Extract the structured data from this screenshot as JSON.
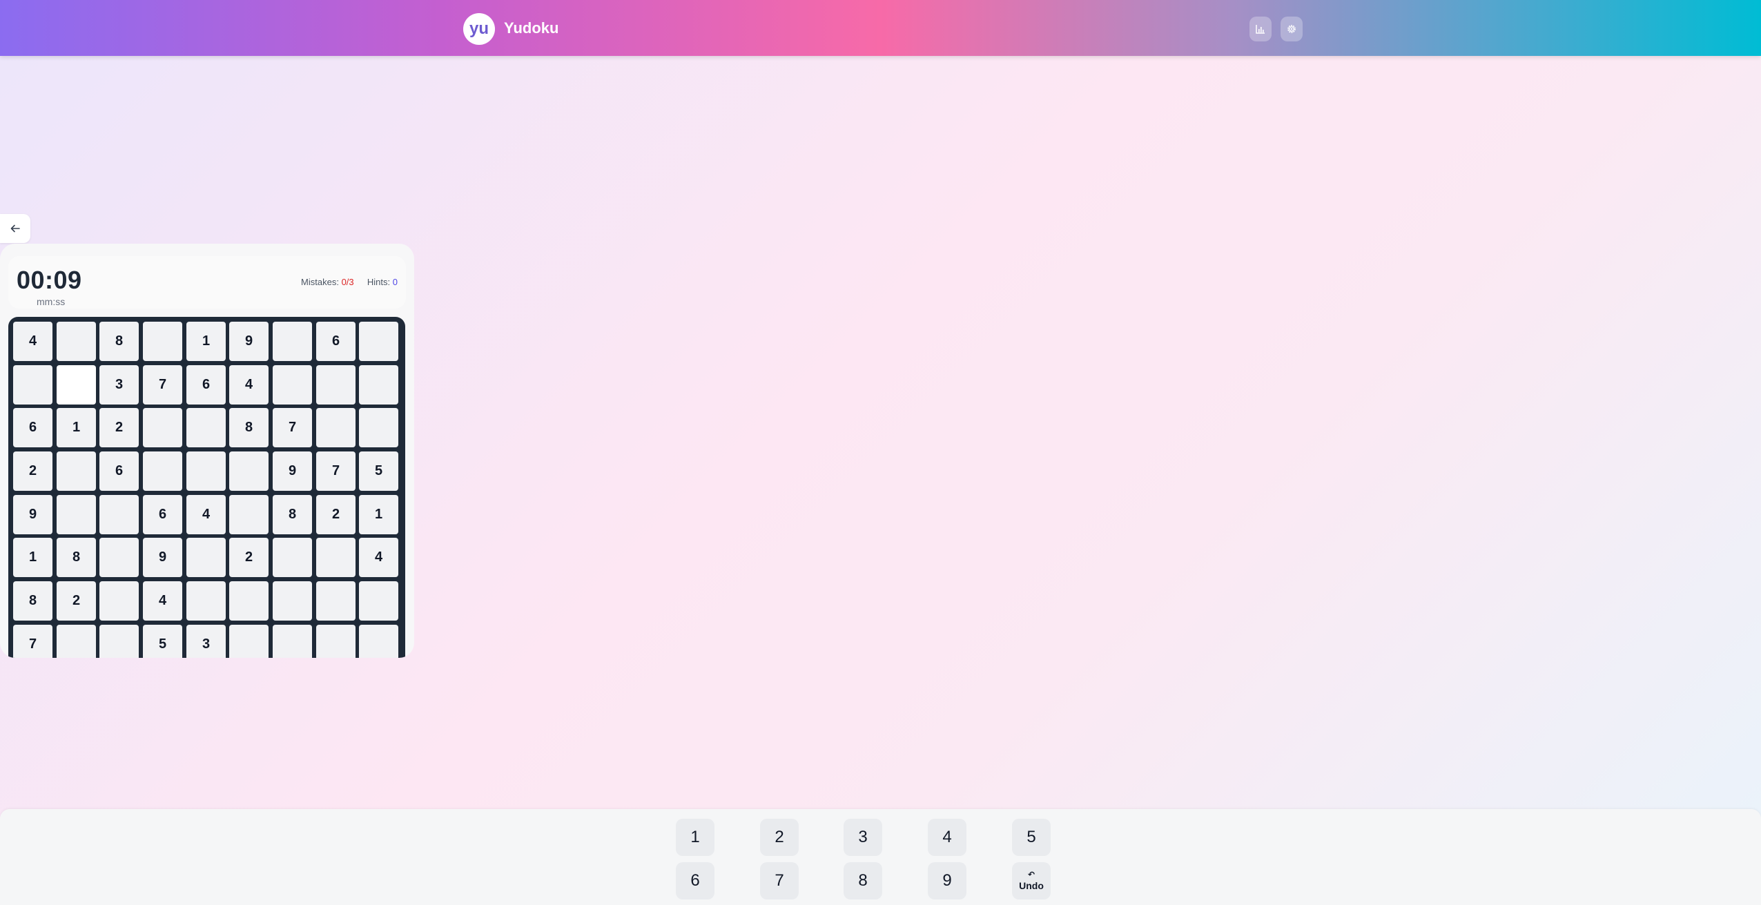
{
  "header": {
    "logo_text": "yu",
    "app_title": "Yudoku",
    "buttons": [
      {
        "name": "stats-button",
        "icon": "bar-chart-icon"
      },
      {
        "name": "settings-button",
        "icon": "gear-icon"
      }
    ]
  },
  "back": {
    "icon": "arrow-left-icon"
  },
  "game": {
    "timer": "00:09",
    "timer_unit": "mm:ss",
    "mistakes_label": "Mistakes:",
    "mistakes_value": "0/3",
    "hints_label": "Hints:",
    "hints_value": "0"
  },
  "board": {
    "rows": [
      [
        "4",
        "",
        "8",
        "",
        "1",
        "9",
        "",
        "6",
        ""
      ],
      [
        "",
        "",
        "3",
        "7",
        "6",
        "4",
        "",
        "",
        ""
      ],
      [
        "6",
        "1",
        "2",
        "",
        "",
        "8",
        "7",
        "",
        ""
      ],
      [
        "2",
        "",
        "6",
        "",
        "",
        "",
        "9",
        "7",
        "5"
      ],
      [
        "9",
        "",
        "",
        "6",
        "4",
        "",
        "8",
        "2",
        "1"
      ],
      [
        "1",
        "8",
        "",
        "9",
        "",
        "2",
        "",
        "",
        "4"
      ],
      [
        "8",
        "2",
        "",
        "4",
        "",
        "",
        "",
        "",
        ""
      ],
      [
        "7",
        "",
        "",
        "5",
        "3",
        "",
        "",
        "",
        ""
      ]
    ],
    "given": [
      [
        1,
        1,
        1,
        1,
        1,
        1,
        1,
        1,
        1
      ],
      [
        1,
        0,
        1,
        1,
        1,
        1,
        1,
        1,
        1
      ],
      [
        1,
        1,
        1,
        1,
        1,
        1,
        1,
        1,
        1
      ],
      [
        1,
        1,
        1,
        1,
        1,
        1,
        1,
        1,
        1
      ],
      [
        1,
        1,
        1,
        1,
        1,
        1,
        1,
        1,
        1
      ],
      [
        1,
        1,
        1,
        1,
        1,
        1,
        1,
        1,
        1
      ],
      [
        1,
        1,
        1,
        1,
        1,
        1,
        1,
        1,
        1
      ],
      [
        1,
        1,
        1,
        1,
        1,
        1,
        1,
        1,
        1
      ]
    ]
  },
  "keypad": {
    "row1": [
      "1",
      "2",
      "3",
      "4",
      "5"
    ],
    "row2": [
      "6",
      "7",
      "8",
      "9"
    ],
    "undo_label": "Undo",
    "undo_icon": "undo-icon"
  },
  "colors": {
    "accent": "#6d5bd0",
    "mistakes": "#dc2626",
    "hints": "#4f46e5",
    "board_border": "#1f2a38"
  }
}
